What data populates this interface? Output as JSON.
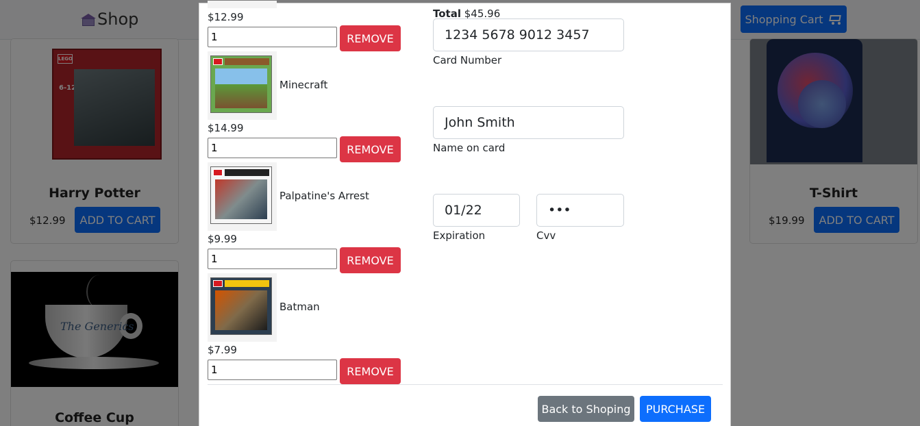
{
  "header": {
    "brand": "Shop",
    "cart_button": "Shopping Cart"
  },
  "products": [
    {
      "title": "Harry Potter",
      "price": "$12.99",
      "button": "ADD TO CART",
      "box_logo": "LEGO",
      "box_age": "6-12"
    },
    {
      "title": "T-Shirt",
      "price": "$19.99",
      "button": "ADD TO CART"
    },
    {
      "title": "Coffee Cup",
      "cup_text": "The Generics"
    }
  ],
  "cart": {
    "first_item_price": "$12.99",
    "first_item_qty": "1",
    "items": [
      {
        "name": "Minecraft",
        "price": "$14.99",
        "qty": "1"
      },
      {
        "name": "Palpatine's Arrest",
        "price": "$9.99",
        "qty": "1"
      },
      {
        "name": "Batman",
        "price": "$7.99",
        "qty": "1"
      }
    ],
    "remove_label": "REMOVE"
  },
  "payment": {
    "total_label": "Total",
    "total_value": "$45.96",
    "card_number": "1234 5678 9012 3457",
    "card_number_label": "Card Number",
    "name_on_card": "John Smith",
    "name_on_card_label": "Name on card",
    "expiration": "01/22",
    "expiration_label": "Expiration",
    "cvv": "•••",
    "cvv_label": "Cvv"
  },
  "footer": {
    "back_label": "Back to Shoping",
    "purchase_label": "PURCHASE"
  },
  "colors": {
    "primary": "#0d6efd",
    "danger": "#dc3545",
    "secondary": "#6c757d"
  }
}
